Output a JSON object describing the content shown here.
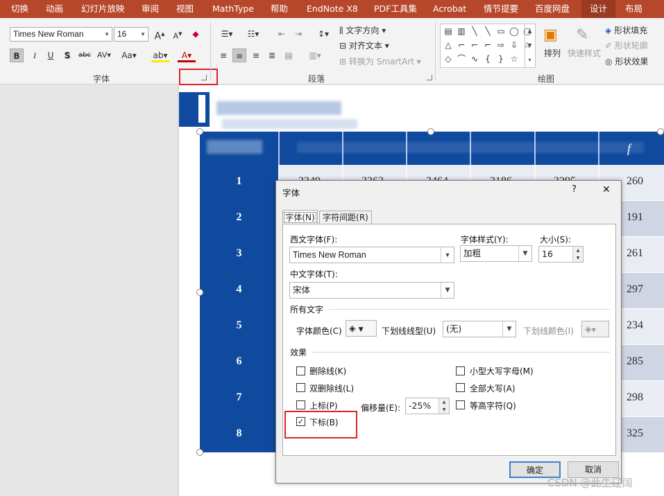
{
  "tabs": [
    "切换",
    "动画",
    "幻灯片放映",
    "审阅",
    "视图",
    "MathType",
    "帮助",
    "EndNote X8",
    "PDF工具集",
    "Acrobat",
    "情节提要",
    "百度网盘",
    "设计",
    "布局"
  ],
  "ribbon": {
    "font_name": "Times New Roman",
    "font_size": "16",
    "grow_font": "A",
    "shrink_font": "A",
    "bold": "B",
    "italic": "I",
    "underline": "U",
    "shadow": "S",
    "strike": "abc",
    "spacing": "AV",
    "change_case": "Aa",
    "highlight": "ab",
    "font_color": "A",
    "text_direction": "文字方向",
    "align_text": "对齐文本",
    "convert_smartart": "转换为 SmartArt",
    "arrange": "排列",
    "quick_styles": "快速样式",
    "shape_fill": "形状填充",
    "shape_outline": "形状轮廓",
    "shape_effects": "形状效果",
    "group_font": "字体",
    "group_paragraph": "段落",
    "group_drawing": "绘图"
  },
  "slide": {
    "row_numbers": [
      "1",
      "2",
      "3",
      "4",
      "5",
      "6",
      "7",
      "8"
    ],
    "visible_values": [
      "260",
      "191",
      "261",
      "297",
      "234",
      "285",
      "298",
      "325"
    ],
    "partial_values": [
      "3349",
      "3363",
      "3464",
      "3186",
      "3295"
    ],
    "header_last": "f"
  },
  "dialog": {
    "title": "字体",
    "help": "?",
    "close": "✕",
    "tabs": [
      "字体(N)",
      "字符间距(R)"
    ],
    "western_font_label": "西文字体(F):",
    "western_font_value": "Times New Roman",
    "style_label": "字体样式(Y):",
    "style_value": "加粗",
    "size_label": "大小(S):",
    "size_value": "16",
    "chinese_font_label": "中文字体(T):",
    "chinese_font_value": "宋体",
    "all_text_label": "所有文字",
    "font_color_label": "字体颜色(C)",
    "underline_style_label": "下划线线型(U)",
    "underline_style_value": "(无)",
    "underline_color_label": "下划线颜色(I)",
    "effects_label": "效果",
    "strikethrough": "删除线(K)",
    "double_strikethrough": "双删除线(L)",
    "superscript": "上标(P)",
    "subscript": "下标(B)",
    "small_caps": "小型大写字母(M)",
    "all_caps": "全部大写(A)",
    "equalize_height": "等高字符(Q)",
    "offset_label": "偏移量(E):",
    "offset_value": "-25%",
    "ok": "确定",
    "cancel": "取消",
    "subscript_checked": true
  },
  "watermark": "CSDN @此生辽阔",
  "colors": {
    "tab_bar": "#b7472a",
    "table_header": "#0f4a9f",
    "table_band_light": "#e9ecf3",
    "table_band_dark": "#cfd5e3",
    "highlight_box": "#e0202a"
  }
}
